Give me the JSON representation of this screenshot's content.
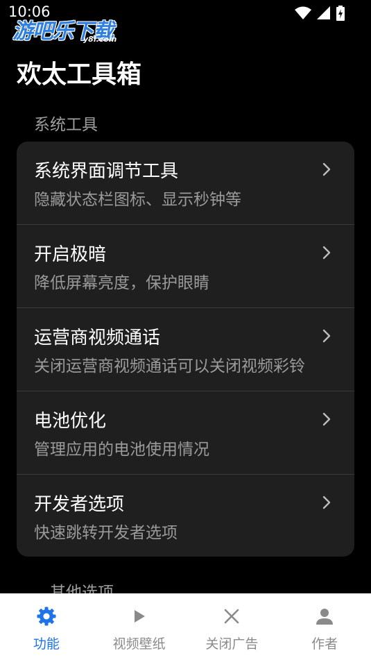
{
  "status_bar": {
    "time": "10:06"
  },
  "watermark": {
    "main": "游吧乐下载",
    "sub": "y8l.com"
  },
  "app": {
    "title": "欢太工具箱"
  },
  "sections": [
    {
      "label": "系统工具",
      "items": [
        {
          "title": "系统界面调节工具",
          "description": "隐藏状态栏图标、显示秒钟等"
        },
        {
          "title": "开启极暗",
          "description": "降低屏幕亮度，保护眼睛"
        },
        {
          "title": "运营商视频通话",
          "description": "关闭运营商视频通话可以关闭视频彩铃"
        },
        {
          "title": "电池优化",
          "description": "管理应用的电池使用情况"
        },
        {
          "title": "开发者选项",
          "description": "快速跳转开发者选项"
        }
      ]
    },
    {
      "label": "其他选项"
    }
  ],
  "bottom_nav": {
    "items": [
      {
        "label": "功能",
        "icon": "gear-icon",
        "active": true
      },
      {
        "label": "视频壁纸",
        "icon": "play-icon",
        "active": false
      },
      {
        "label": "关闭广告",
        "icon": "close-icon",
        "active": false
      },
      {
        "label": "作者",
        "icon": "person-icon",
        "active": false
      }
    ]
  },
  "colors": {
    "background": "#000000",
    "card": "#1f1f1f",
    "accent": "#1e73e8",
    "secondary_text": "#9a9a9a",
    "nav_background": "#ffffff"
  }
}
